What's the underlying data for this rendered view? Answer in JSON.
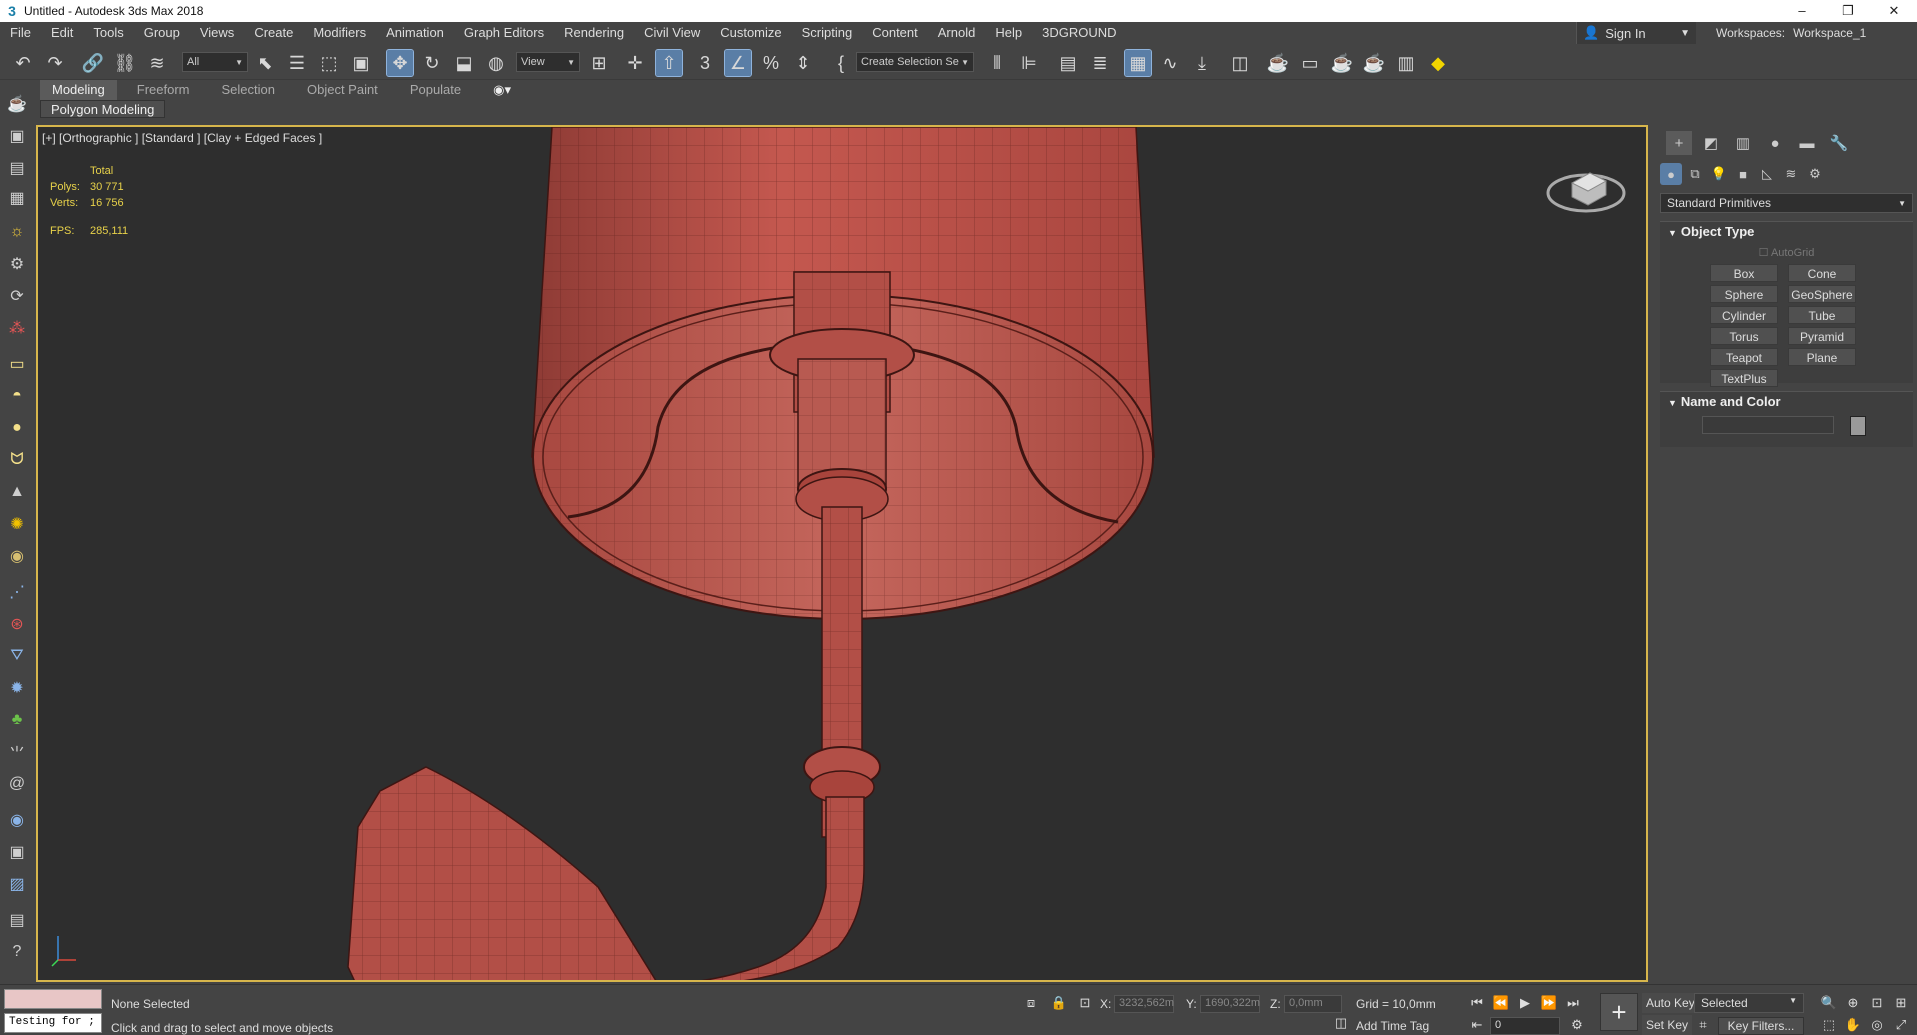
{
  "window": {
    "title": "Untitled - Autodesk 3ds Max 2018",
    "app_icon": "3",
    "buttons": {
      "minimize": "–",
      "restore": "❐",
      "close": "✕"
    }
  },
  "menu": [
    "File",
    "Edit",
    "Tools",
    "Group",
    "Views",
    "Create",
    "Modifiers",
    "Animation",
    "Graph Editors",
    "Rendering",
    "Civil View",
    "Customize",
    "Scripting",
    "Content",
    "Arnold",
    "Help",
    "3DGROUND"
  ],
  "account": {
    "sign_in": "Sign In",
    "workspaces_label": "Workspaces:",
    "workspace_value": "Workspace_1"
  },
  "toolbar": {
    "selection_filter": "All",
    "ref_coord": "View",
    "named_selection": "Create Selection Se"
  },
  "ribbon": {
    "tabs": [
      "Modeling",
      "Freeform",
      "Selection",
      "Object Paint",
      "Populate"
    ],
    "active_tab": "Modeling",
    "panel_label": "Polygon Modeling"
  },
  "viewport": {
    "label": "[+] [Orthographic ] [Standard ] [Clay + Edged Faces ]",
    "stats": {
      "total_label": "Total",
      "polys_label": "Polys:",
      "polys": "30 771",
      "verts_label": "Verts:",
      "verts": "16 756",
      "fps_label": "FPS:",
      "fps": "285,111"
    },
    "accent_color": "#d7b64c",
    "mesh_color": "#b6504a"
  },
  "command_panel": {
    "category": "Standard Primitives",
    "object_type": {
      "header": "Object Type",
      "autogrid": "AutoGrid",
      "buttons": [
        "Box",
        "Cone",
        "Sphere",
        "GeoSphere",
        "Cylinder",
        "Tube",
        "Torus",
        "Pyramid",
        "Teapot",
        "Plane",
        "TextPlus"
      ]
    },
    "name_and_color": {
      "header": "Name and Color"
    }
  },
  "status": {
    "selection": "None Selected",
    "prompt": "Click and drag to select and move objects",
    "listener": "Testing for ;",
    "x_label": "X:",
    "x": "3232,562m",
    "y_label": "Y:",
    "y": "1690,322m",
    "z_label": "Z:",
    "z": "0,0mm",
    "grid": "Grid = 10,0mm",
    "add_time_tag": "Add Time Tag",
    "auto_key": "Auto Key",
    "set_key": "Set Key",
    "selected": "Selected",
    "frame": "0",
    "key_filters": "Key Filters..."
  }
}
